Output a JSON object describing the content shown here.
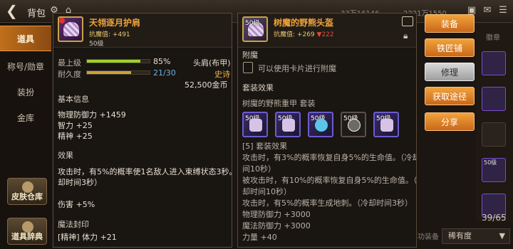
{
  "header": {
    "title": "背包",
    "currency1": "33万16146",
    "currency2": "2221万1550"
  },
  "sidebar": {
    "items": [
      {
        "label": "道具",
        "active": true
      },
      {
        "label": "称号/勋章",
        "active": false
      },
      {
        "label": "装扮",
        "active": false
      },
      {
        "label": "金库",
        "active": false
      }
    ],
    "tiles": [
      {
        "label": "皮肤仓库"
      },
      {
        "label": "道具辞典"
      }
    ]
  },
  "left_panel": {
    "item_name": "天翎逐月护肩",
    "stat_label": "抗魔值:",
    "stat_value": "+491",
    "level": "50级",
    "max_level_label": "最上级",
    "max_level_pct": "85%",
    "max_level_fill": 0.85,
    "durability_label": "耐久度",
    "durability_value": "21/30",
    "durability_fill": 0.7,
    "slot_type": "头肩(布甲)",
    "rarity": "史诗",
    "price": "52,500金币",
    "basic_title": "基本信息",
    "stats": [
      "物理防御力 +1459",
      "智力 +25",
      "精神 +25"
    ],
    "effect_title": "效果",
    "effect_line1": "攻击时，有5%的概率使1名敌人进入束缚状态3秒。（冷",
    "effect_line2": "却时间3秒）",
    "damage": "伤害 +5%",
    "magic_seal_title": "魔法封印",
    "magic_seal_row": "[精神] 体力 +21"
  },
  "right_panel": {
    "item_name": "树魔的野熊头盔",
    "icon_level": "50级",
    "stat_label": "抗魔值:",
    "stat_up": "+269",
    "stat_down": "▼222",
    "enchant_title": "附魔",
    "enchant_text": "可以使用卡片进行附魔",
    "set_title": "套装效果",
    "set_name": "树魔的野熊重甲  套装",
    "set_icons": [
      {
        "level": "50级",
        "kind": "purple"
      },
      {
        "level": "50级",
        "kind": "purple"
      },
      {
        "level": "50级",
        "kind": "blue"
      },
      {
        "level": "50级",
        "kind": "gray"
      },
      {
        "level": "50级",
        "kind": "purple"
      }
    ],
    "set_effect_header": "[5] 套装效果",
    "set_lines": [
      "攻击时，有3%的概率恢复自身5%的生命值。（冷却时",
      "间10秒）",
      "被攻击时，有10%的概率恢复自身5%的生命值。（冷",
      "却时间10秒）",
      "攻击时，有5%的概率生成地刺。（冷却时间3秒）",
      "物理防御力 +3000",
      "魔法防御力 +3000",
      "力量 +40"
    ]
  },
  "actions": {
    "equip": "装备",
    "smith": "铁匠铺",
    "repair": "修理",
    "obtain": "获取途径",
    "share": "分享"
  },
  "inventory": {
    "tab_hint": "徽章",
    "cell_level": "50级",
    "count": "39/65",
    "sort_label": "稀有度",
    "bottom_hint": "功装备"
  },
  "colors": {
    "accent": "#f2a33a",
    "epic": "#e9b54a",
    "danger": "#e24b3b"
  }
}
